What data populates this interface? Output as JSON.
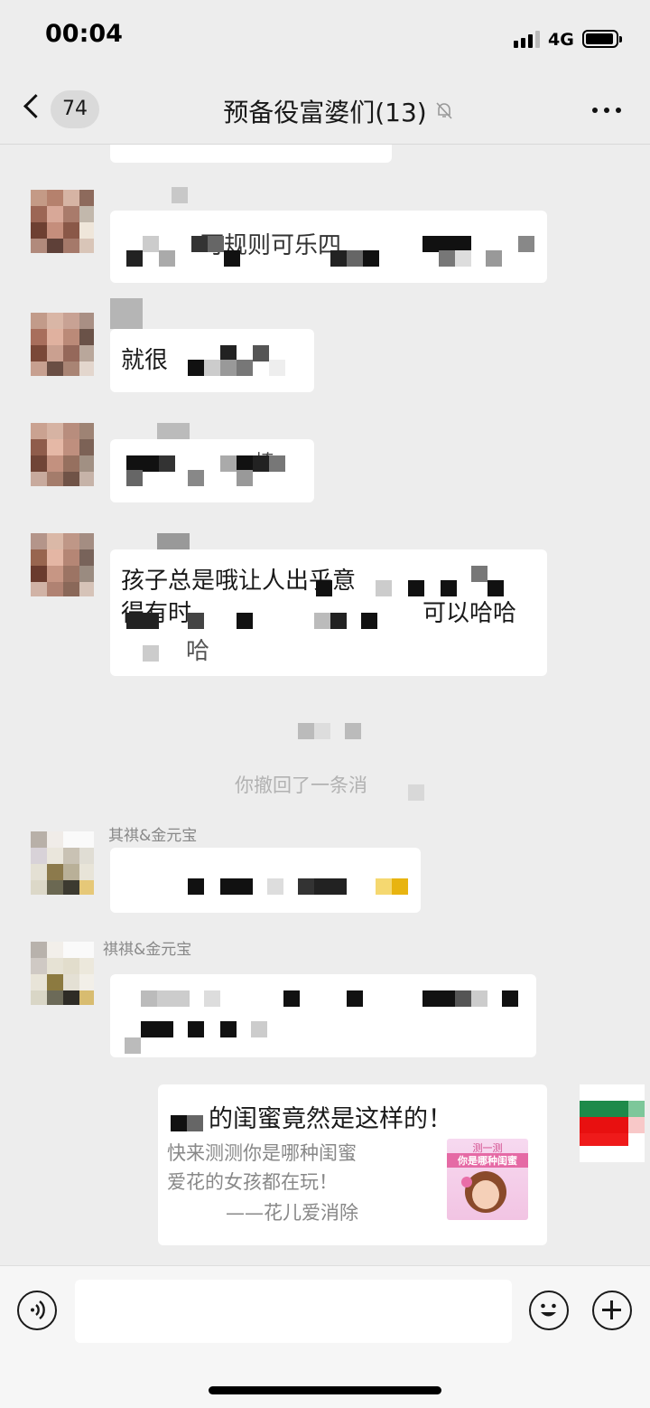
{
  "status_bar": {
    "time": "00:04",
    "network": "4G"
  },
  "header": {
    "unread_count": "74",
    "title": "预备役富婆们(13)"
  },
  "messages": [
    {
      "partial_text": "可规则可乐四"
    },
    {
      "text": "就很"
    },
    {
      "text": "棒"
    },
    {
      "line1": "孩子总是哦让人出乎意",
      "line2": "得有时",
      "line2_end": "可以哈哈",
      "line3": "哈"
    },
    {
      "sender": "其祺&金元宝"
    },
    {
      "sender": "祺祺&金元宝"
    }
  ],
  "system_notice": "你撤回了一条消",
  "share_card": {
    "title": "的闺蜜竟然是这样的！",
    "desc_line1": "快来测测你是哪种闺蜜",
    "desc_line2": "爱花的女孩都在玩！",
    "source": "——花儿爱消除",
    "thumb_top": "测一测",
    "thumb_bottom": "你是哪种闺蜜"
  },
  "input": {
    "placeholder": ""
  }
}
